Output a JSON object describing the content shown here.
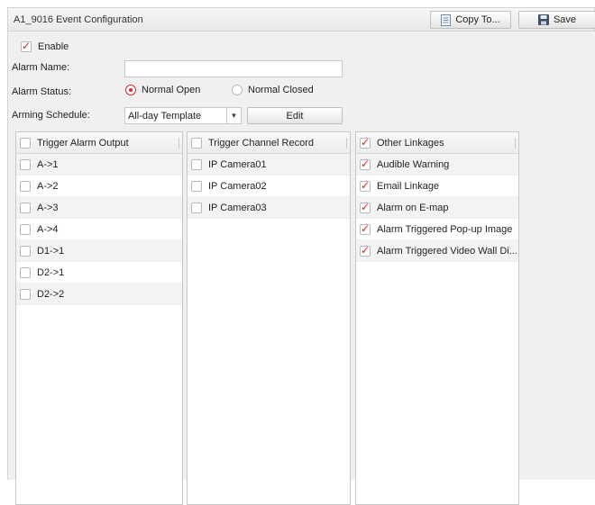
{
  "window": {
    "title": "A1_9016 Event Configuration",
    "copy_label": "Copy To...",
    "save_label": "Save"
  },
  "form": {
    "enable_label": "Enable",
    "enable_checked": true,
    "alarm_name_label": "Alarm Name:",
    "alarm_name_value": "",
    "alarm_status_label": "Alarm Status:",
    "status_options": [
      "Normal Open",
      "Normal Closed"
    ],
    "status_selected": "Normal Open",
    "arming_label": "Arming Schedule:",
    "arming_value": "All-day Template",
    "edit_label": "Edit"
  },
  "panels": {
    "alarm_output": {
      "header": "Trigger Alarm Output",
      "header_checked": false,
      "items": [
        {
          "label": "A->1",
          "checked": false
        },
        {
          "label": "A->2",
          "checked": false
        },
        {
          "label": "A->3",
          "checked": false
        },
        {
          "label": "A->4",
          "checked": false
        },
        {
          "label": "D1->1",
          "checked": false
        },
        {
          "label": "D2->1",
          "checked": false
        },
        {
          "label": "D2->2",
          "checked": false
        }
      ]
    },
    "channel_record": {
      "header": "Trigger Channel Record",
      "header_checked": false,
      "items": [
        {
          "label": "IP Camera01",
          "checked": false
        },
        {
          "label": "IP Camera02",
          "checked": false
        },
        {
          "label": "IP Camera03",
          "checked": false
        }
      ]
    },
    "other_linkages": {
      "header": "Other Linkages",
      "header_checked": true,
      "items": [
        {
          "label": "Audible Warning",
          "checked": true
        },
        {
          "label": "Email Linkage",
          "checked": true
        },
        {
          "label": "Alarm on E-map",
          "checked": true
        },
        {
          "label": "Alarm Triggered Pop-up Image",
          "checked": true
        },
        {
          "label": "Alarm Triggered Video Wall Di...",
          "checked": true
        }
      ]
    }
  },
  "colors": {
    "accent": "#d42b2b",
    "background": "#f0f0f0"
  }
}
